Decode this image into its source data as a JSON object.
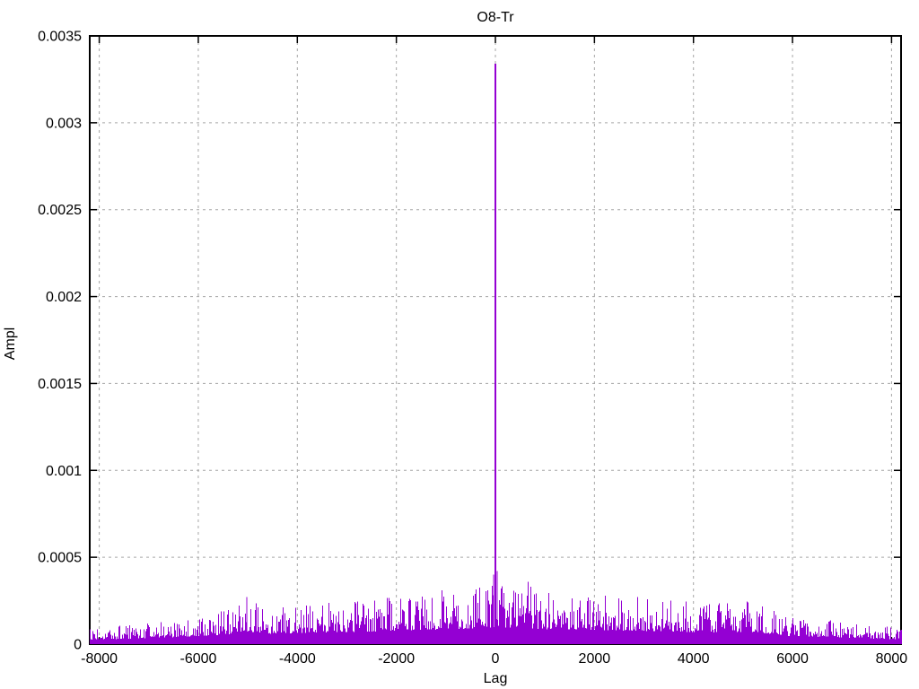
{
  "window": {
    "background": "#ffffff"
  },
  "chart_data": {
    "type": "impulses",
    "title": "O8-Tr",
    "xlabel": "Lag",
    "ylabel": "Ampl",
    "xlim": [
      -8192,
      8192
    ],
    "ylim": [
      0,
      0.0035
    ],
    "xticks": [
      {
        "v": -8000,
        "label": "-8000"
      },
      {
        "v": -6000,
        "label": "-6000"
      },
      {
        "v": -4000,
        "label": "-4000"
      },
      {
        "v": -2000,
        "label": "-2000"
      },
      {
        "v": 0,
        "label": "0"
      },
      {
        "v": 2000,
        "label": "2000"
      },
      {
        "v": 4000,
        "label": "4000"
      },
      {
        "v": 6000,
        "label": "6000"
      },
      {
        "v": 8000,
        "label": "8000"
      }
    ],
    "yticks": [
      {
        "v": 0,
        "label": "0"
      },
      {
        "v": 0.0005,
        "label": "0.0005"
      },
      {
        "v": 0.001,
        "label": "0.001"
      },
      {
        "v": 0.0015,
        "label": "0.0015"
      },
      {
        "v": 0.002,
        "label": "0.002"
      },
      {
        "v": 0.0025,
        "label": "0.0025"
      },
      {
        "v": 0.003,
        "label": "0.003"
      },
      {
        "v": 0.0035,
        "label": "0.0035"
      }
    ],
    "grid": {
      "visible": true,
      "color": "#a6a6a6",
      "dash": "3,4"
    },
    "colors": {
      "line": "#9400d3",
      "axis": "#000000",
      "background": "#ffffff",
      "text": "#000000"
    },
    "peak": {
      "lag": 0,
      "ampl": 0.00334
    },
    "secondary_spikes": [
      {
        "lag": -5020,
        "ampl": 0.00027
      },
      {
        "lag": -1080,
        "ampl": 0.00031
      },
      {
        "lag": -35,
        "ampl": 0.0004
      },
      {
        "lag": 40,
        "ampl": 0.00042
      },
      {
        "lag": 660,
        "ampl": 0.00036
      },
      {
        "lag": 720,
        "ampl": 0.00033
      },
      {
        "lag": 5100,
        "ampl": 0.00024
      }
    ],
    "noise_envelope": {
      "lags": [
        -8192,
        -7500,
        -6500,
        -5500,
        -5000,
        -4500,
        -3500,
        -2500,
        -1500,
        -800,
        -300,
        0,
        300,
        800,
        1500,
        2500,
        3500,
        4500,
        5200,
        6000,
        7000,
        8192
      ],
      "max_ampl": [
        9e-05,
        0.00011,
        0.00014,
        0.00019,
        0.00026,
        0.00021,
        0.00024,
        0.00026,
        0.00029,
        0.00031,
        0.00033,
        0.00034,
        0.00034,
        0.00031,
        0.0003,
        0.00028,
        0.00026,
        0.00024,
        0.00025,
        0.00016,
        0.00013,
        0.0001
      ]
    },
    "noise_seed": 20240
  }
}
